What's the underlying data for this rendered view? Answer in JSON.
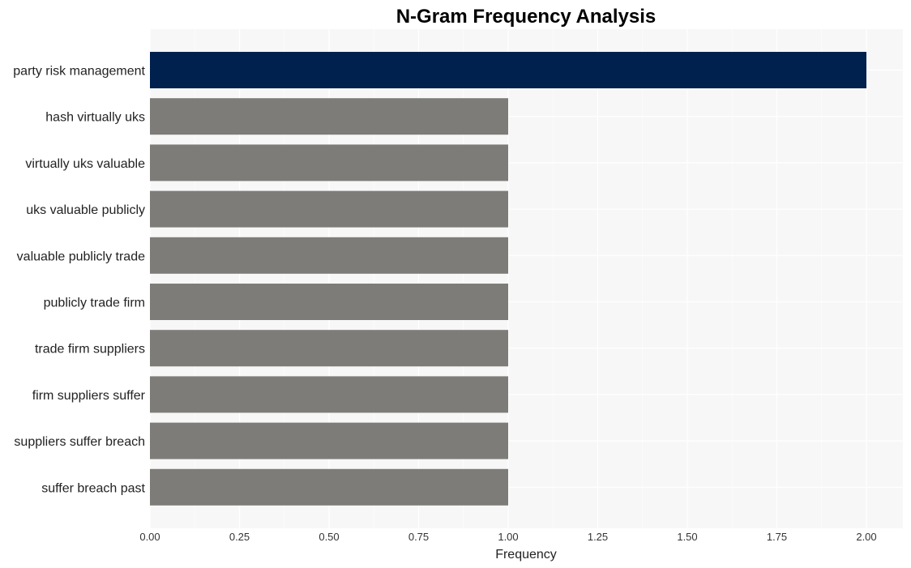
{
  "chart_data": {
    "type": "bar",
    "orientation": "horizontal",
    "title": "N-Gram Frequency Analysis",
    "xlabel": "Frequency",
    "ylabel": "",
    "categories": [
      "party risk management",
      "hash virtually uks",
      "virtually uks valuable",
      "uks valuable publicly",
      "valuable publicly trade",
      "publicly trade firm",
      "trade firm suppliers",
      "firm suppliers suffer",
      "suppliers suffer breach",
      "suffer breach past"
    ],
    "values": [
      2,
      1,
      1,
      1,
      1,
      1,
      1,
      1,
      1,
      1
    ],
    "xlim": [
      0,
      2.1
    ],
    "xticks": [
      0,
      0.25,
      0.5,
      0.75,
      1.0,
      1.25,
      1.5,
      1.75,
      2.0
    ],
    "xtick_labels": [
      "0.00",
      "0.25",
      "0.50",
      "0.75",
      "1.00",
      "1.25",
      "1.50",
      "1.75",
      "2.00"
    ],
    "grid": true,
    "legend": "none",
    "colors": {
      "highlight": "#00214d",
      "default": "#7d7c78",
      "panel": "#f7f7f7",
      "grid": "#ffffff"
    }
  }
}
